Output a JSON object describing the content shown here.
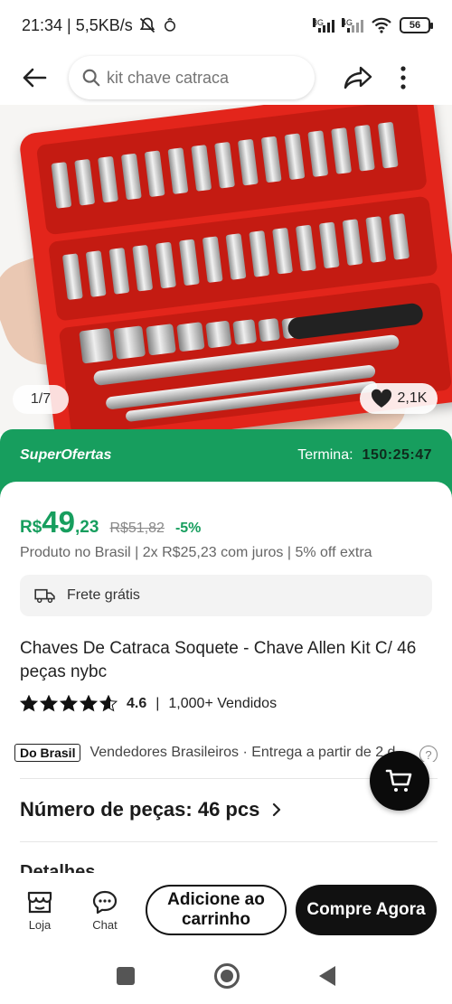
{
  "status_bar": {
    "time_speed": "21:34 | 5,5KB/s",
    "net_3g": "3G",
    "net_4g": "4G",
    "battery": "56"
  },
  "app_bar": {
    "search_placeholder": "kit chave catraca"
  },
  "gallery": {
    "counter": "1/7",
    "likes": "2,1K"
  },
  "super_offers": {
    "title": "SuperOfertas",
    "ends_label": "Termina:",
    "countdown": "150:25:47"
  },
  "price": {
    "currency": "R$",
    "integer": "49",
    "decimal": ",23",
    "original": "R$51,82",
    "discount": "-5%",
    "subtitle": "Produto no Brasil | 2x R$25,23 com juros | 5% off extra"
  },
  "shipping": {
    "label": "Frete grátis"
  },
  "product": {
    "title": "Chaves De Catraca Soquete - Chave Allen Kit C/ 46 peças nybc",
    "rating": "4.6",
    "rating_stars": 4.6,
    "sold": "1,000+ Vendidos"
  },
  "seller": {
    "badge": "Do Brasil",
    "text": "Vendedores Brasileiros · Entrega a partir de 2 d",
    "help": "?"
  },
  "variant": {
    "label": "Número de peças: 46 pcs"
  },
  "details": {
    "title": "Detalhes"
  },
  "bottom_bar": {
    "store_label": "Loja",
    "chat_label": "Chat",
    "add_to_cart": "Adicione ao carrinho",
    "buy_now": "Compre Agora"
  },
  "colors": {
    "accent_green": "#179e5e",
    "case_red": "#e3251b",
    "button_black": "#111111"
  }
}
